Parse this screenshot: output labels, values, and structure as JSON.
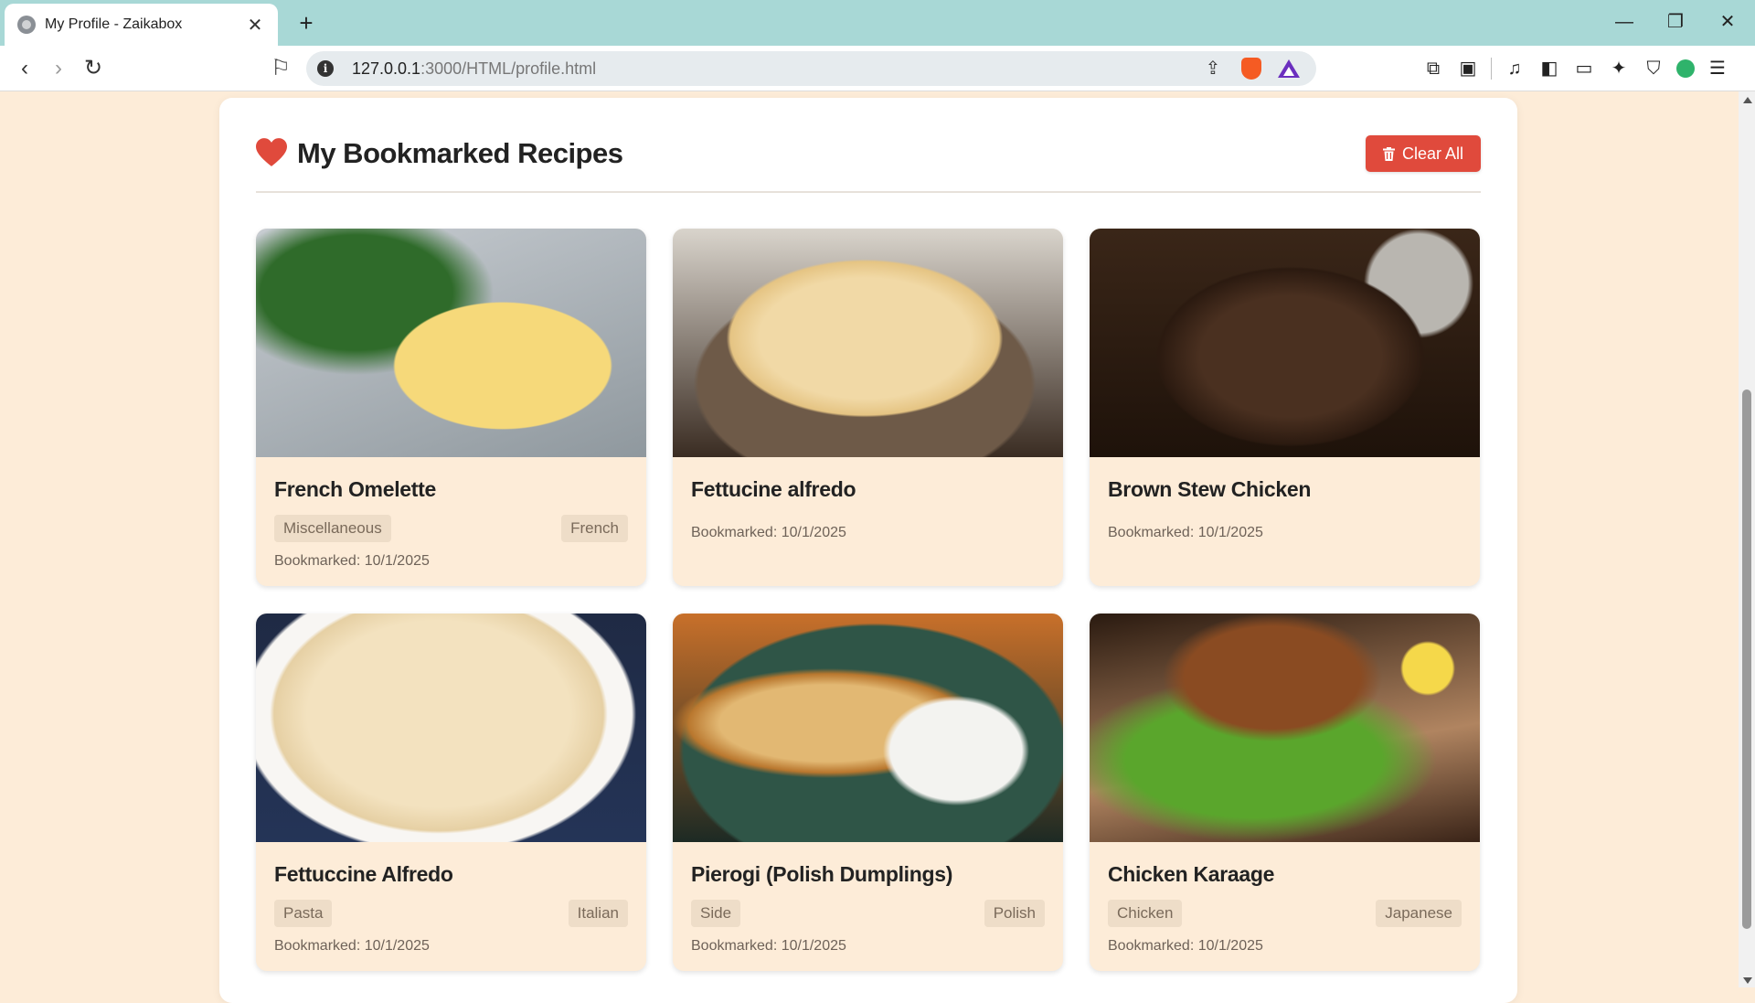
{
  "browser": {
    "tab_title": "My Profile - Zaikabox",
    "url_host": "127.0.0.1",
    "url_rest": ":3000/HTML/profile.html"
  },
  "page": {
    "section_title": "My Bookmarked Recipes",
    "clear_all_label": "Clear All",
    "colors": {
      "background": "#fdecd8",
      "accent": "#e04a3c",
      "heart": "#e04a3c",
      "tag_bg": "#eeddc8"
    }
  },
  "recipes": [
    {
      "title": "French Omelette",
      "category": "Miscellaneous",
      "area": "French",
      "bookmarked": "Bookmarked: 10/1/2025",
      "image": "omelette"
    },
    {
      "title": "Fettucine alfredo",
      "category": "",
      "area": "",
      "bookmarked": "Bookmarked: 10/1/2025",
      "image": "fettucine"
    },
    {
      "title": "Brown Stew Chicken",
      "category": "",
      "area": "",
      "bookmarked": "Bookmarked: 10/1/2025",
      "image": "stew"
    },
    {
      "title": "Fettuccine Alfredo",
      "category": "Pasta",
      "area": "Italian",
      "bookmarked": "Bookmarked: 10/1/2025",
      "image": "fettuccine"
    },
    {
      "title": "Pierogi (Polish Dumplings)",
      "category": "Side",
      "area": "Polish",
      "bookmarked": "Bookmarked: 10/1/2025",
      "image": "pierogi"
    },
    {
      "title": "Chicken Karaage",
      "category": "Chicken",
      "area": "Japanese",
      "bookmarked": "Bookmarked: 10/1/2025",
      "image": "karaage"
    }
  ]
}
